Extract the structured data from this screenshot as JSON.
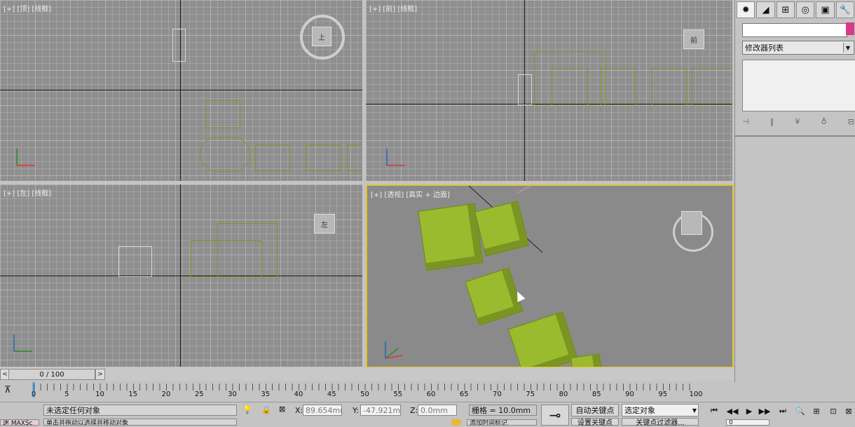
{
  "viewports": {
    "top": {
      "label": "[+] [顶] [线框]"
    },
    "front": {
      "label": "[+] [前] [线框]",
      "viewcube": "前"
    },
    "left": {
      "label": "[+] [左] [线框]",
      "viewcube": "左"
    },
    "persp": {
      "label": "[+] [透视] [真实 + 边面]"
    }
  },
  "viewcube_top": "上",
  "axis_labels": {
    "x": "x",
    "y": "y",
    "z": "z"
  },
  "command_panel": {
    "tabs": [
      "create-icon",
      "modify-icon",
      "hierarchy-icon",
      "motion-icon",
      "display-icon",
      "utilities-icon"
    ],
    "name_value": "",
    "modifier_list_label": "修改器列表",
    "accent_color": "#d83a8a"
  },
  "time_slider": {
    "position": "0 / 100",
    "left_arrow": "<",
    "right_arrow": ">"
  },
  "ruler_ticks": [
    "0",
    "5",
    "10",
    "15",
    "20",
    "25",
    "30",
    "35",
    "40",
    "45",
    "50",
    "55",
    "60",
    "65",
    "70",
    "75",
    "80",
    "85",
    "90",
    "95",
    "100"
  ],
  "status_bar": {
    "maxscript": "迷 MAXSc",
    "selection_text": "未选定任何对象",
    "prompt_text": "单击并拖动以选择并移动对象",
    "x_label": "X:",
    "x_value": "89.654mm",
    "y_label": "Y:",
    "y_value": "-47.921mm",
    "z_label": "Z:",
    "z_value": "0.0mm",
    "grid_text": "栅格 = 10.0mm",
    "add_time_tag": "添加时间标记",
    "auto_key": "自动关键点",
    "set_key": "设置关键点",
    "selected_dropdown": "选定对象",
    "key_filters": "关键点过滤器...",
    "frame_value": "0"
  }
}
